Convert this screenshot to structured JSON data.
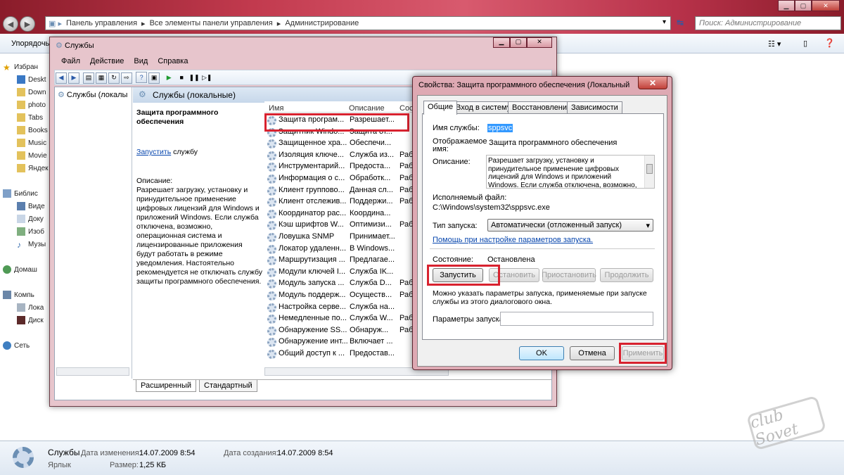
{
  "explorer": {
    "breadcrumb": [
      "Панель управления",
      "Все элементы панели управления",
      "Администрирование"
    ],
    "search_placeholder": "Поиск: Администрирование",
    "toolbar_label": "Упорядочь",
    "nav_groups": [
      {
        "label": "Избран",
        "items": [
          "Deskt",
          "Down",
          "photo",
          "Tabs",
          "Books",
          "Music",
          "Movie",
          "Яндек"
        ]
      },
      {
        "label": "Библис",
        "items": [
          "Виде",
          "Доку",
          "Изоб",
          "Музы"
        ]
      },
      {
        "label": "Домаш",
        "items": []
      },
      {
        "label": "Компь",
        "items": [
          "Лока",
          "Диск"
        ]
      },
      {
        "label": "Сеть",
        "items": []
      }
    ],
    "status": {
      "name": "Службы",
      "type": "Ярлык",
      "modified_label": "Дата изменения:",
      "modified": "14.07.2009 8:54",
      "size_label": "Размер:",
      "size": "1,25 КБ",
      "created_label": "Дата создания:",
      "created": "14.07.2009 8:54"
    }
  },
  "services": {
    "title": "Службы",
    "menu": [
      "Файл",
      "Действие",
      "Вид",
      "Справка"
    ],
    "tree_item": "Службы (локалы",
    "header": "Службы (локальные)",
    "selected_name": "Защита программного обеспечения",
    "start_link": "Запустить",
    "start_link_suffix": " службу",
    "desc_label": "Описание:",
    "description": "Разрешает загрузку, установку и принудительное применение цифровых лицензий для Windows и приложений Windows. Если служба отключена, возможно, операционная система и лицензированные приложения будут работать в режиме уведомления. Настоятельно рекомендуется не отключать службу защиты программного обеспечения.",
    "columns": [
      "Имя",
      "Описание",
      "Сост"
    ],
    "rows": [
      {
        "name": "Защита програм...",
        "desc": "Разрешает...",
        "state": ""
      },
      {
        "name": "Защитник Windo...",
        "desc": "Защита от...",
        "state": ""
      },
      {
        "name": "Защищенное хра...",
        "desc": "Обеспечи...",
        "state": ""
      },
      {
        "name": "Изоляция ключе...",
        "desc": "Служба из...",
        "state": "Рабо"
      },
      {
        "name": "Инструментарий...",
        "desc": "Предоста...",
        "state": "Рабо"
      },
      {
        "name": "Информация о с...",
        "desc": "Обработк...",
        "state": "Рабо"
      },
      {
        "name": "Клиент группово...",
        "desc": "Данная сл...",
        "state": "Рабо"
      },
      {
        "name": "Клиент отслежив...",
        "desc": "Поддержи...",
        "state": "Рабо"
      },
      {
        "name": "Координатор рас...",
        "desc": "Координа...",
        "state": ""
      },
      {
        "name": "Кэш шрифтов W...",
        "desc": "Оптимизи...",
        "state": "Рабо"
      },
      {
        "name": "Ловушка SNMP",
        "desc": "Принимает...",
        "state": ""
      },
      {
        "name": "Локатор удаленн...",
        "desc": "В Windows...",
        "state": ""
      },
      {
        "name": "Маршрутизация ...",
        "desc": "Предлагае...",
        "state": ""
      },
      {
        "name": "Модули ключей I...",
        "desc": "Служба IK...",
        "state": ""
      },
      {
        "name": "Модуль запуска ...",
        "desc": "Служба D...",
        "state": "Рабо"
      },
      {
        "name": "Модуль поддерж...",
        "desc": "Осуществ...",
        "state": "Рабо"
      },
      {
        "name": "Настройка серве...",
        "desc": "Служба на...",
        "state": ""
      },
      {
        "name": "Немедленные по...",
        "desc": "Служба W...",
        "state": "Рабо"
      },
      {
        "name": "Обнаружение SS...",
        "desc": "Обнаруж...",
        "state": "Рабо"
      },
      {
        "name": "Обнаружение инт...",
        "desc": "Включает ...",
        "state": ""
      },
      {
        "name": "Общий доступ к ...",
        "desc": "Предостав...",
        "state": ""
      }
    ],
    "tab_extended": "Расширенный",
    "tab_standard": "Стандартный"
  },
  "dialog": {
    "title": "Свойства: Защита программного обеспечения (Локальный ко...",
    "tabs": [
      "Общие",
      "Вход в систему",
      "Восстановление",
      "Зависимости"
    ],
    "service_name_label": "Имя службы:",
    "service_name": "sppsvc",
    "display_name_label_1": "Отображаемое",
    "display_name_label_2": "имя:",
    "display_name": "Защита программного обеспечения",
    "description_label": "Описание:",
    "description": "Разрешает загрузку, установку и принудительное применение цифровых лицензий для Windows и приложений Windows. Если служба отключена, возможно,",
    "exe_label": "Исполняемый файл:",
    "exe_path": "C:\\Windows\\system32\\sppsvc.exe",
    "startup_type_label": "Тип запуска:",
    "startup_type": "Автоматически (отложенный запуск)",
    "help_link": "Помощь при настройке параметров запуска.",
    "state_label": "Состояние:",
    "state": "Остановлена",
    "btn_start": "Запустить",
    "btn_stop": "Остановить",
    "btn_pause": "Приостановить",
    "btn_resume": "Продолжить",
    "params_hint": "Можно указать параметры запуска, применяемые при запуске службы из этого диалогового окна.",
    "params_label": "Параметры запуска:",
    "params_value": "",
    "btn_ok": "OK",
    "btn_cancel": "Отмена",
    "btn_apply": "Применить"
  },
  "colors": {
    "highlight": "#d8222f",
    "link": "#0645ad",
    "selection": "#3399ff"
  }
}
